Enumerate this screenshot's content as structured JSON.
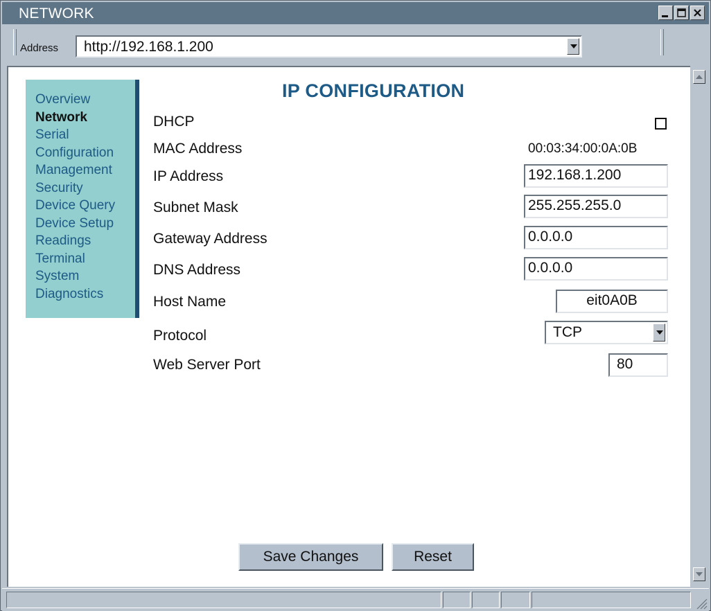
{
  "window": {
    "title": "NETWORK"
  },
  "address_bar": {
    "label": "Address",
    "url": "http://192.168.1.200"
  },
  "sidebar": {
    "items": [
      {
        "label": "Overview",
        "active": false
      },
      {
        "label": "Network",
        "active": true
      },
      {
        "label": "Serial",
        "active": false
      },
      {
        "label": "Configuration",
        "active": false
      },
      {
        "label": "Management",
        "active": false
      },
      {
        "label": "Security",
        "active": false
      },
      {
        "label": "Device Query",
        "active": false
      },
      {
        "label": "Device Setup",
        "active": false
      },
      {
        "label": "Readings",
        "active": false
      },
      {
        "label": "Terminal",
        "active": false
      },
      {
        "label": "System",
        "active": false
      },
      {
        "label": "Diagnostics",
        "active": false
      }
    ]
  },
  "form": {
    "heading": "IP CONFIGURATION",
    "dhcp": {
      "label": "DHCP",
      "checked": false
    },
    "mac": {
      "label": "MAC Address",
      "value": "00:03:34:00:0A:0B"
    },
    "ip": {
      "label": "IP Address",
      "value": "192.168.1.200"
    },
    "subnet": {
      "label": "Subnet Mask",
      "value": "255.255.255.0"
    },
    "gateway": {
      "label": "Gateway Address",
      "value": "0.0.0.0"
    },
    "dns": {
      "label": "DNS Address",
      "value": "0.0.0.0"
    },
    "host": {
      "label": "Host Name",
      "value": "eit0A0B"
    },
    "protocol": {
      "label": "Protocol",
      "value": "TCP"
    },
    "port": {
      "label": "Web Server Port",
      "value": "80"
    }
  },
  "buttons": {
    "save": "Save Changes",
    "reset": "Reset"
  },
  "colors": {
    "titlebar": "#5e7587",
    "sidebar": "#92cfce",
    "accent": "#1e5a86",
    "chrome": "#b9c4cf"
  }
}
